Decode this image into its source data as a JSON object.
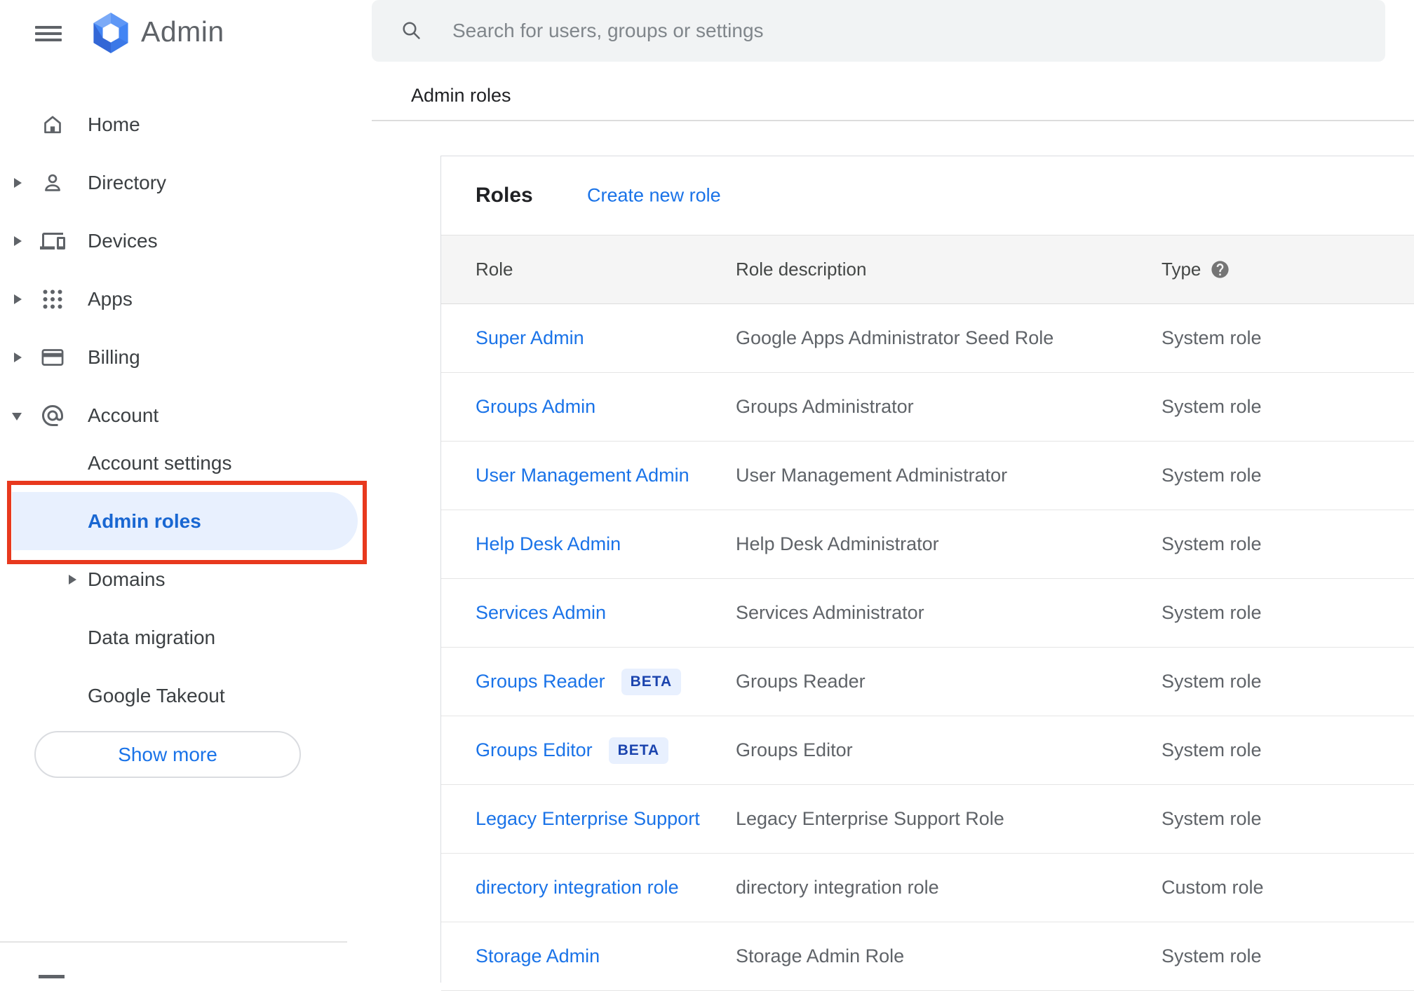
{
  "app": {
    "title": "Admin"
  },
  "topbar": {
    "search_placeholder": "Search for users, groups or settings"
  },
  "breadcrumb": {
    "label": "Admin roles"
  },
  "sidebar": {
    "items": [
      {
        "label": "Home",
        "icon": "home-icon",
        "arrow": "none"
      },
      {
        "label": "Directory",
        "icon": "person-icon",
        "arrow": "right"
      },
      {
        "label": "Devices",
        "icon": "devices-icon",
        "arrow": "right"
      },
      {
        "label": "Apps",
        "icon": "apps-icon",
        "arrow": "right"
      },
      {
        "label": "Billing",
        "icon": "billing-icon",
        "arrow": "right"
      },
      {
        "label": "Account",
        "icon": "at-icon",
        "arrow": "down"
      }
    ],
    "account_children": [
      {
        "label": "Account settings",
        "arrow": "none",
        "selected": false
      },
      {
        "label": "Admin roles",
        "arrow": "none",
        "selected": true,
        "annotated": true
      },
      {
        "label": "Domains",
        "arrow": "right",
        "selected": false
      },
      {
        "label": "Data migration",
        "arrow": "none",
        "selected": false
      },
      {
        "label": "Google Takeout",
        "arrow": "none",
        "selected": false
      }
    ],
    "show_more_label": "Show more"
  },
  "roles_panel": {
    "title": "Roles",
    "create_link": "Create new role",
    "table": {
      "columns": [
        "Role",
        "Role description",
        "Type"
      ],
      "beta_badge_label": "BETA",
      "rows": [
        {
          "role": "Super Admin",
          "beta": false,
          "description": "Google Apps Administrator Seed Role",
          "type": "System role"
        },
        {
          "role": "Groups Admin",
          "beta": false,
          "description": "Groups Administrator",
          "type": "System role"
        },
        {
          "role": "User Management Admin",
          "beta": false,
          "description": "User Management Administrator",
          "type": "System role"
        },
        {
          "role": "Help Desk Admin",
          "beta": false,
          "description": "Help Desk Administrator",
          "type": "System role"
        },
        {
          "role": "Services Admin",
          "beta": false,
          "description": "Services Administrator",
          "type": "System role"
        },
        {
          "role": "Groups Reader",
          "beta": true,
          "description": "Groups Reader",
          "type": "System role"
        },
        {
          "role": "Groups Editor",
          "beta": true,
          "description": "Groups Editor",
          "type": "System role"
        },
        {
          "role": "Legacy Enterprise Support",
          "beta": false,
          "description": "Legacy Enterprise Support Role",
          "type": "System role"
        },
        {
          "role": "directory integration role",
          "beta": false,
          "description": "directory integration role",
          "type": "Custom role"
        },
        {
          "role": "Storage Admin",
          "beta": false,
          "description": "Storage Admin Role",
          "type": "System role"
        }
      ]
    }
  },
  "colors": {
    "link_blue": "#1a73e8",
    "selected_blue": "#1967d2",
    "selected_bg": "#e8f0fe",
    "annotation_red": "#e8391e",
    "icon_gray": "#5f6368",
    "table_text_gray": "#5f6368",
    "thead_bg": "#f5f5f5",
    "search_bg": "#f1f3f4"
  }
}
